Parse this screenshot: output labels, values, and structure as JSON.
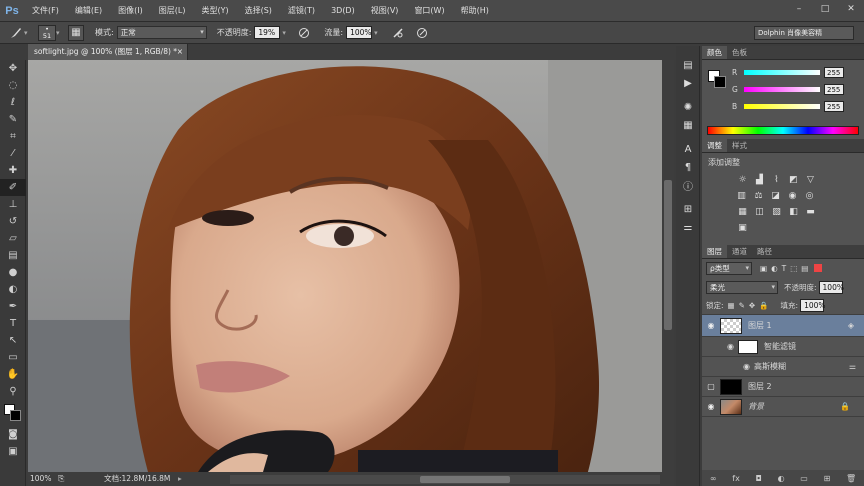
{
  "app": {
    "logo": "Ps"
  },
  "menu": [
    "文件(F)",
    "编辑(E)",
    "图像(I)",
    "图层(L)",
    "类型(Y)",
    "选择(S)",
    "滤镜(T)",
    "3D(D)",
    "视图(V)",
    "窗口(W)",
    "帮助(H)"
  ],
  "options": {
    "brush_size": "51",
    "mode_label": "模式:",
    "mode_value": "正常",
    "opacity_label": "不透明度:",
    "opacity_value": "19%",
    "flow_label": "流量:",
    "flow_value": "100%",
    "workspace": "Dolphin 肖像美容精"
  },
  "document": {
    "tab_title": "softlight.jpg @ 100% (图层 1, RGB/8) *",
    "close": "×",
    "zoom": "100%",
    "doc_info": "文档:12.8M/16.8M"
  },
  "color_panel": {
    "tabs": [
      "颜色",
      "色板"
    ],
    "rows": [
      {
        "label": "R",
        "value": "255"
      },
      {
        "label": "G",
        "value": "255"
      },
      {
        "label": "B",
        "value": "255"
      }
    ]
  },
  "adjust_panel": {
    "tabs": [
      "调整",
      "样式"
    ],
    "title": "添加调整"
  },
  "layers_panel": {
    "tabs": [
      "图层",
      "通道",
      "路径"
    ],
    "filter_kind": "ρ类型",
    "blend_mode": "柔光",
    "opacity_label": "不透明度:",
    "opacity_value": "100%",
    "lock_label": "锁定:",
    "fill_label": "填充:",
    "fill_value": "100%",
    "layers": [
      {
        "name": "图层 1"
      },
      {
        "name": "智能滤镜"
      },
      {
        "name": "高斯模糊"
      },
      {
        "name": "图层 2"
      },
      {
        "name": "背景"
      }
    ]
  },
  "colors": {
    "accent_selected": "#6a7f9c",
    "fg": "#ffffff",
    "bg": "#000000"
  }
}
